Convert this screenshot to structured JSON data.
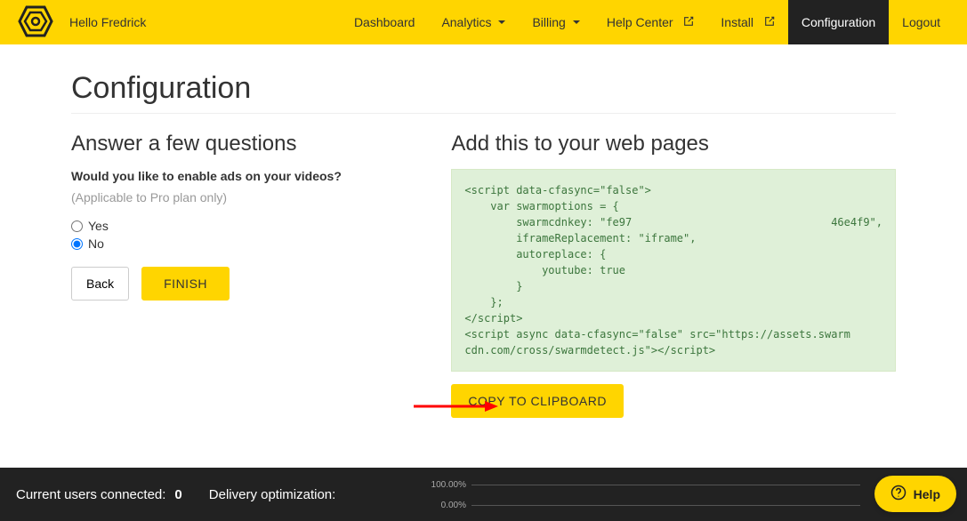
{
  "header": {
    "greeting": "Hello Fredrick",
    "nav": {
      "dashboard": "Dashboard",
      "analytics": "Analytics",
      "billing": "Billing",
      "help_center": "Help Center",
      "install": "Install",
      "configuration": "Configuration",
      "logout": "Logout"
    }
  },
  "page": {
    "title": "Configuration"
  },
  "left": {
    "heading": "Answer a few questions",
    "question": "Would you like to enable ads on your videos?",
    "note": "(Applicable to Pro plan only)",
    "options": {
      "yes": "Yes",
      "no": "No"
    },
    "back": "Back",
    "finish": "FINISH"
  },
  "right": {
    "heading": "Add this to your web pages",
    "code": "<script data-cfasync=\"false\">\n    var swarmoptions = {\n        swarmcdnkey: \"fe97                               46e4f9\",\n        iframeReplacement: \"iframe\",\n        autoreplace: {\n            youtube: true\n        }\n    };\n</script>\n<script async data-cfasync=\"false\" src=\"https://assets.swarm\ncdn.com/cross/swarmdetect.js\"></script>",
    "copy": "COPY TO CLIPBOARD"
  },
  "footer": {
    "users_label": "Current users connected:",
    "users_value": "0",
    "delivery_label": "Delivery optimization:",
    "pct_100": "100.00%",
    "pct_0": "0.00%"
  },
  "help": {
    "label": "Help"
  }
}
